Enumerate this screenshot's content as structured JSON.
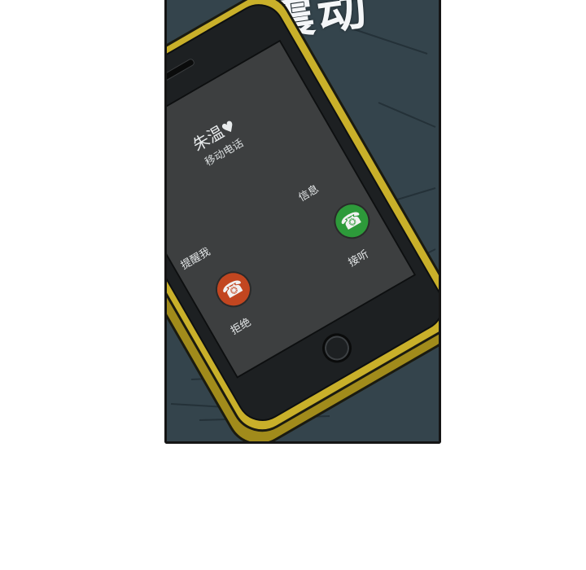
{
  "sfx_text": "震动",
  "phone": {
    "caller_name": "朱温",
    "caller_heart": "♥",
    "caller_subtitle": "移动电话",
    "actions": {
      "remind": "提醒我",
      "message": "信息",
      "decline": "拒绝",
      "answer": "接听"
    },
    "icons": {
      "decline": "phone-icon",
      "answer": "phone-icon"
    }
  },
  "colors": {
    "panel_background": "#34444c",
    "phone_case": "#c9b02a",
    "decline": "#c24620",
    "answer": "#2d9a3a"
  }
}
